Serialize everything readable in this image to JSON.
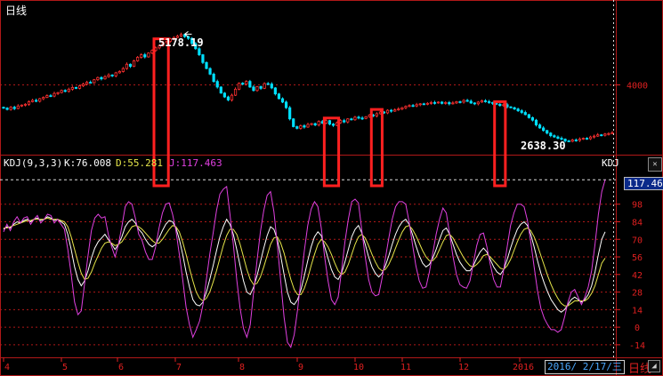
{
  "header": {
    "title": "日线"
  },
  "kdj": {
    "params_label": "KDJ(9,3,3)",
    "k_label": "K:76.008",
    "d_label": "D:55.281",
    "j_label": "J:117.463",
    "right_tag": "KDJ",
    "current_value": "117.46"
  },
  "price_annotations": {
    "high": "5178.19",
    "low": "2638.30"
  },
  "footer": {
    "date_label": "2016/ 2/17/三",
    "period_label": "日线",
    "month_ticks": [
      "4",
      "5",
      "6",
      "7",
      "8",
      "9",
      "10",
      "11",
      "12",
      "2016"
    ]
  },
  "colors": {
    "up": "#ff3030",
    "down": "#00e0ff",
    "k": "#ffffff",
    "d": "#e6e64a",
    "j": "#e040e0",
    "frame": "#b01818",
    "highlight": "#ff2020",
    "axis_text": "#e02020"
  },
  "chart_data": [
    {
      "type": "candlestick",
      "title": "日线",
      "y_ticks": [
        4000
      ],
      "ylim": [
        2400,
        5600
      ],
      "annotations": [
        {
          "text": "5178.19",
          "x": 49,
          "y": 5178.19
        },
        {
          "text": "2638.30",
          "x": 183,
          "y": 2638.3
        }
      ],
      "close": [
        3460,
        3430,
        3480,
        3450,
        3510,
        3530,
        3550,
        3610,
        3640,
        3620,
        3680,
        3710,
        3750,
        3740,
        3800,
        3820,
        3870,
        3850,
        3900,
        3940,
        3920,
        3980,
        4020,
        4060,
        4050,
        4120,
        4170,
        4140,
        4190,
        4230,
        4210,
        4280,
        4310,
        4380,
        4480,
        4430,
        4560,
        4640,
        4700,
        4650,
        4740,
        4800,
        4860,
        4910,
        4980,
        5010,
        5070,
        5100,
        5130,
        5170,
        5120,
        5080,
        4960,
        4840,
        4700,
        4520,
        4380,
        4250,
        4080,
        3950,
        3810,
        3720,
        3650,
        3760,
        3900,
        4040,
        4020,
        4080,
        3950,
        3870,
        3960,
        3920,
        4030,
        4020,
        3930,
        3790,
        3680,
        3600,
        3470,
        3210,
        3030,
        2990,
        3050,
        3020,
        3080,
        3100,
        3070,
        3150,
        3110,
        3170,
        3090,
        3060,
        3120,
        3170,
        3140,
        3210,
        3190,
        3250,
        3230,
        3220,
        3260,
        3300,
        3280,
        3330,
        3370,
        3350,
        3410,
        3390,
        3420,
        3440,
        3470,
        3500,
        3520,
        3510,
        3540,
        3560,
        3550,
        3570,
        3590,
        3580,
        3600,
        3570,
        3590,
        3560,
        3580,
        3610,
        3600,
        3640,
        3620,
        3580,
        3560,
        3600,
        3630,
        3610,
        3590,
        3570,
        3550,
        3520,
        3540,
        3490,
        3470,
        3440,
        3400,
        3360,
        3310,
        3240,
        3180,
        3070,
        3000,
        2940,
        2880,
        2820,
        2790,
        2760,
        2740,
        2700,
        2690,
        2720,
        2710,
        2740,
        2760,
        2750,
        2790,
        2810,
        2840,
        2830,
        2860,
        2870,
        2890
      ],
      "months": [
        "4",
        "5",
        "6",
        "7",
        "8",
        "9",
        "10",
        "11",
        "12",
        "2016"
      ],
      "highlight_ranges": [
        [
          42,
          45
        ],
        [
          89,
          92
        ],
        [
          102,
          104
        ],
        [
          136,
          138
        ],
        [
          187,
          189
        ]
      ]
    },
    {
      "type": "line",
      "title": "KDJ(9,3,3)",
      "y_ticks": [
        -14,
        0,
        14,
        28,
        42,
        56,
        70,
        84,
        98
      ],
      "ylim": [
        -24,
        124
      ],
      "series": [
        {
          "name": "K",
          "values": [
            78,
            80,
            79,
            82,
            84,
            83,
            85,
            86,
            84,
            86,
            87,
            85,
            86,
            88,
            87,
            85,
            86,
            84,
            82,
            74,
            62,
            48,
            38,
            33,
            37,
            45,
            55,
            63,
            68,
            71,
            74,
            70,
            66,
            62,
            66,
            72,
            80,
            84,
            86,
            83,
            78,
            75,
            70,
            66,
            64,
            66,
            71,
            77,
            82,
            85,
            84,
            79,
            70,
            58,
            44,
            32,
            22,
            18,
            17,
            20,
            28,
            38,
            49,
            61,
            72,
            80,
            86,
            82,
            74,
            62,
            49,
            37,
            28,
            26,
            32,
            41,
            52,
            63,
            73,
            80,
            78,
            70,
            57,
            42,
            28,
            20,
            18,
            22,
            30,
            41,
            53,
            64,
            72,
            76,
            73,
            64,
            55,
            46,
            40,
            38,
            43,
            52,
            62,
            72,
            78,
            81,
            75,
            66,
            56,
            48,
            43,
            40,
            43,
            49,
            57,
            66,
            74,
            80,
            84,
            86,
            82,
            74,
            65,
            57,
            51,
            48,
            50,
            55,
            62,
            70,
            77,
            79,
            74,
            66,
            58,
            52,
            48,
            45,
            45,
            49,
            55,
            60,
            63,
            60,
            54,
            48,
            44,
            42,
            46,
            54,
            63,
            71,
            78,
            82,
            84,
            81,
            74,
            64,
            53,
            43,
            35,
            28,
            22,
            18,
            14,
            12,
            14,
            18,
            22,
            24,
            22,
            20,
            22,
            26,
            33,
            44,
            58,
            70,
            76
          ]
        },
        {
          "name": "D",
          "values": [
            79,
            79,
            80,
            81,
            82,
            83,
            84,
            85,
            85,
            86,
            86,
            86,
            86,
            87,
            86,
            86,
            86,
            85,
            84,
            80,
            72,
            62,
            52,
            43,
            38,
            39,
            44,
            51,
            57,
            63,
            67,
            68,
            67,
            65,
            66,
            68,
            72,
            76,
            80,
            81,
            80,
            78,
            75,
            72,
            69,
            67,
            67,
            70,
            74,
            78,
            81,
            80,
            76,
            68,
            58,
            47,
            37,
            28,
            23,
            21,
            23,
            28,
            36,
            45,
            55,
            65,
            73,
            78,
            78,
            74,
            66,
            56,
            46,
            38,
            34,
            35,
            40,
            48,
            57,
            66,
            71,
            72,
            67,
            59,
            48,
            38,
            30,
            26,
            26,
            31,
            39,
            49,
            58,
            66,
            70,
            68,
            64,
            58,
            51,
            45,
            42,
            44,
            50,
            58,
            66,
            72,
            74,
            71,
            65,
            58,
            52,
            47,
            45,
            46,
            50,
            56,
            63,
            70,
            76,
            80,
            81,
            78,
            73,
            67,
            61,
            56,
            53,
            53,
            56,
            62,
            68,
            73,
            74,
            71,
            66,
            61,
            56,
            52,
            49,
            48,
            50,
            53,
            57,
            58,
            56,
            53,
            50,
            47,
            46,
            49,
            54,
            61,
            68,
            74,
            78,
            79,
            77,
            72,
            65,
            57,
            49,
            41,
            34,
            28,
            23,
            19,
            17,
            17,
            19,
            21,
            21,
            21,
            21,
            23,
            27,
            33,
            42,
            51,
            55
          ]
        },
        {
          "name": "J",
          "values": [
            76,
            82,
            77,
            84,
            88,
            83,
            87,
            88,
            82,
            86,
            89,
            83,
            86,
            90,
            89,
            83,
            86,
            82,
            78,
            62,
            42,
            20,
            10,
            13,
            35,
            57,
            77,
            87,
            90,
            87,
            88,
            74,
            64,
            56,
            66,
            80,
            96,
            100,
            98,
            87,
            74,
            69,
            60,
            54,
            54,
            64,
            79,
            91,
            98,
            99,
            90,
            77,
            58,
            38,
            16,
            2,
            -8,
            -2,
            5,
            18,
            38,
            58,
            75,
            93,
            106,
            110,
            112,
            90,
            66,
            38,
            15,
            -1,
            -8,
            2,
            28,
            53,
            76,
            93,
            105,
            108,
            92,
            66,
            37,
            8,
            -12,
            -16,
            -6,
            14,
            38,
            61,
            81,
            94,
            100,
            96,
            79,
            56,
            37,
            22,
            18,
            24,
            45,
            68,
            86,
            100,
            102,
            99,
            77,
            56,
            38,
            28,
            25,
            26,
            39,
            55,
            71,
            86,
            96,
            100,
            100,
            98,
            84,
            66,
            49,
            37,
            31,
            32,
            44,
            59,
            74,
            86,
            95,
            91,
            74,
            56,
            42,
            34,
            32,
            31,
            37,
            51,
            65,
            74,
            75,
            64,
            50,
            38,
            32,
            32,
            46,
            64,
            81,
            91,
            98,
            98,
            96,
            85,
            68,
            48,
            29,
            15,
            7,
            2,
            -2,
            -2,
            -4,
            -2,
            8,
            20,
            28,
            30,
            24,
            18,
            24,
            32,
            45,
            66,
            90,
            108,
            117.46
          ]
        }
      ],
      "months": [
        "4",
        "5",
        "6",
        "7",
        "8",
        "9",
        "10",
        "11",
        "12",
        "2016"
      ]
    }
  ]
}
